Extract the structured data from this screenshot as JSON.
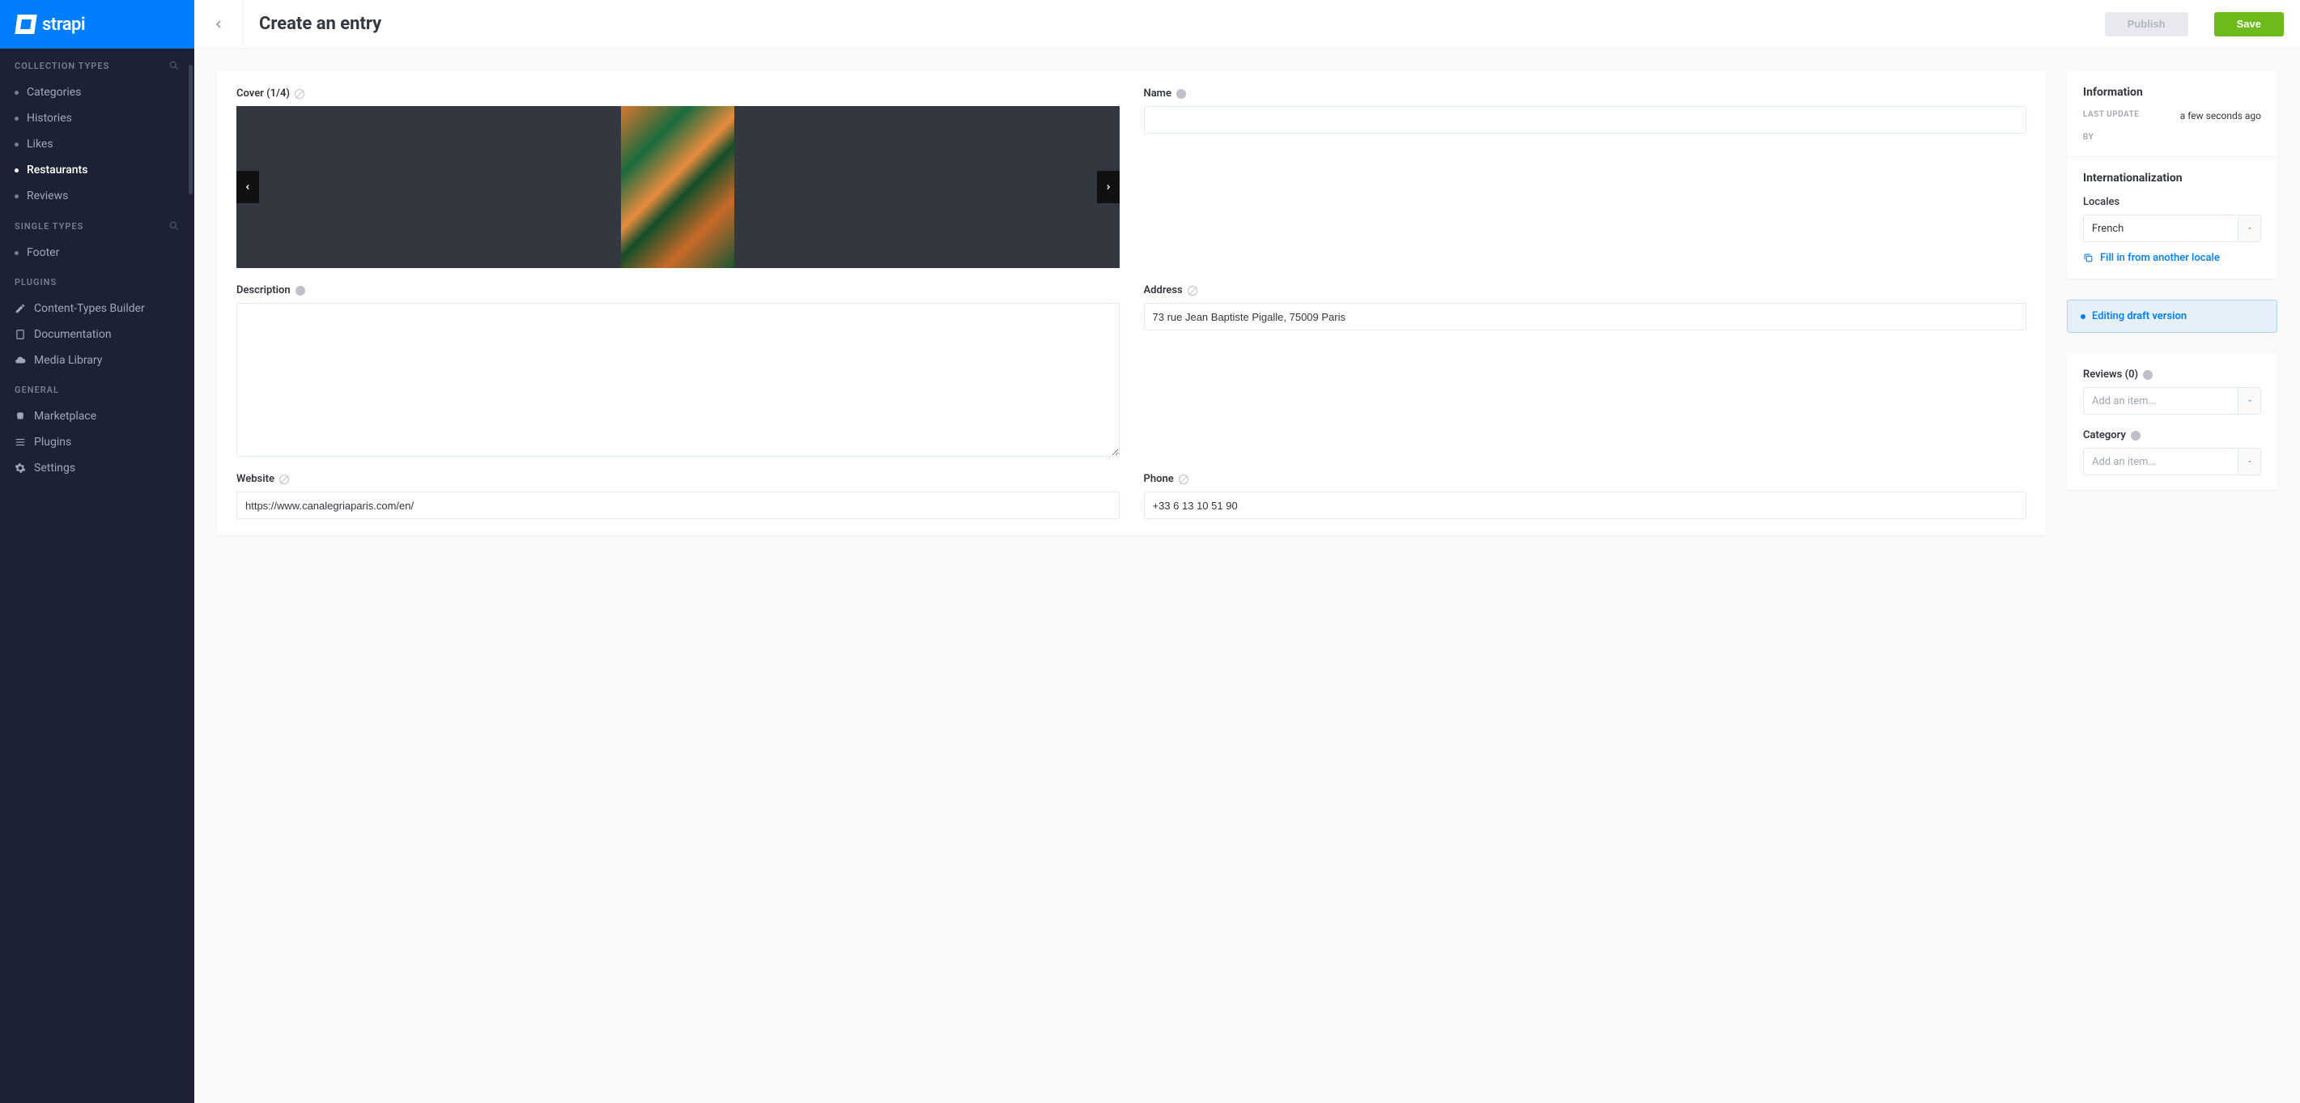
{
  "brand": "strapi",
  "sidebar": {
    "collection_types_label": "COLLECTION TYPES",
    "single_types_label": "SINGLE TYPES",
    "plugins_label": "PLUGINS",
    "general_label": "GENERAL",
    "collection_items": [
      {
        "label": "Categories"
      },
      {
        "label": "Histories"
      },
      {
        "label": "Likes"
      },
      {
        "label": "Restaurants",
        "active": true
      },
      {
        "label": "Reviews"
      }
    ],
    "single_items": [
      {
        "label": "Footer"
      }
    ],
    "plugin_items": [
      {
        "label": "Content-Types Builder",
        "icon": "pencil"
      },
      {
        "label": "Documentation",
        "icon": "book"
      },
      {
        "label": "Media Library",
        "icon": "cloud"
      }
    ],
    "general_items": [
      {
        "label": "Marketplace",
        "icon": "basket"
      },
      {
        "label": "Plugins",
        "icon": "list"
      },
      {
        "label": "Settings",
        "icon": "gear"
      }
    ]
  },
  "header": {
    "title": "Create an entry",
    "publish_label": "Publish",
    "save_label": "Save"
  },
  "form": {
    "cover_label": "Cover (1/4)",
    "name_label": "Name",
    "name_value": "",
    "description_label": "Description",
    "description_value": "",
    "address_label": "Address",
    "address_value": "73 rue Jean Baptiste Pigalle, 75009 Paris",
    "website_label": "Website",
    "website_value": "https://www.canalegriaparis.com/en/",
    "phone_label": "Phone",
    "phone_value": "+33 6 13 10 51 90"
  },
  "info_panel": {
    "title": "Information",
    "last_update_label": "LAST UPDATE",
    "last_update_value": "a few seconds ago",
    "by_label": "BY",
    "by_value": ""
  },
  "i18n_panel": {
    "title": "Internationalization",
    "locales_label": "Locales",
    "locale_value": "French",
    "fill_link": "Fill in from another locale"
  },
  "draft": {
    "editing_label": "Editing",
    "version_label": "draft version"
  },
  "relations": {
    "reviews_label": "Reviews (0)",
    "reviews_placeholder": "Add an item...",
    "category_label": "Category",
    "category_placeholder": "Add an item..."
  }
}
